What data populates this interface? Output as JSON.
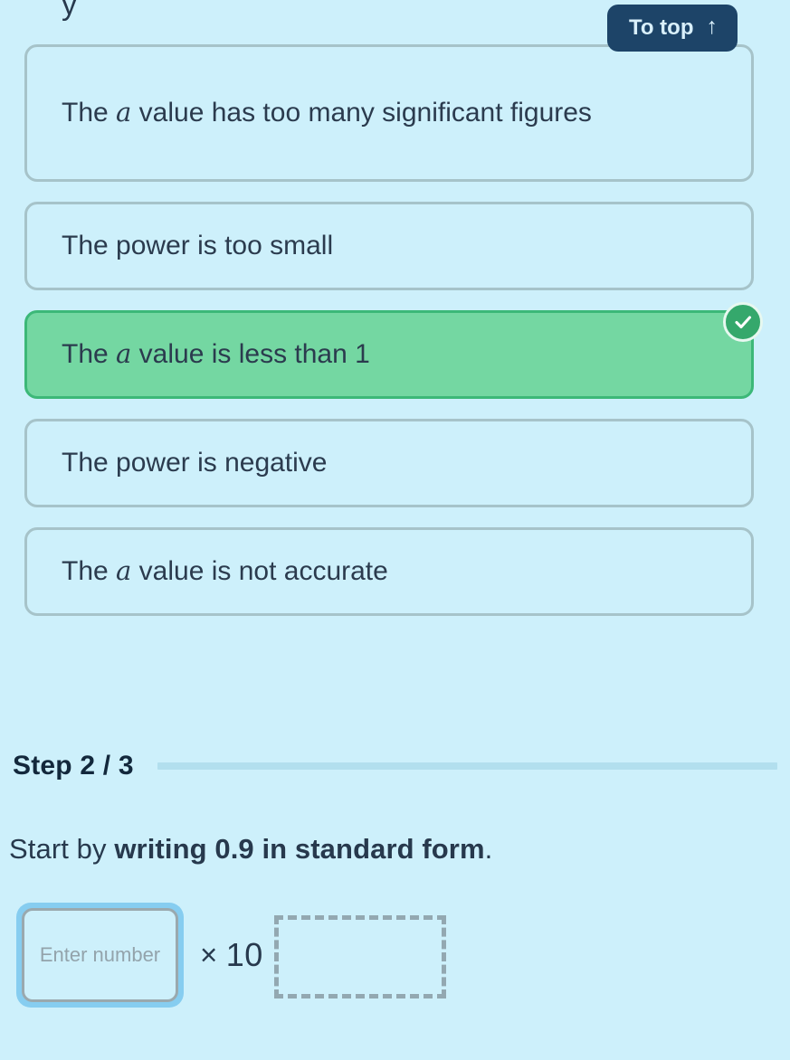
{
  "page": {
    "background_color": "#cdf0fb",
    "text_color": "#27394d",
    "cut_off_descender": "y"
  },
  "to_top": {
    "label": "To top",
    "icon": "arrow-up-icon",
    "arrow_glyph": "↑",
    "background_color": "#1d4468",
    "text_color": "#d9f0fb"
  },
  "options": {
    "selected_index": 2,
    "items": [
      {
        "prefix": "The ",
        "variable": "a",
        "suffix": " value has too many significant figures",
        "full_text": "The a value has too many significant figures",
        "selected": false,
        "lines": 2
      },
      {
        "prefix": "The power is too small",
        "variable": "",
        "suffix": "",
        "full_text": "The power is too small",
        "selected": false,
        "lines": 1
      },
      {
        "prefix": "The ",
        "variable": "a",
        "suffix": " value is less than 1",
        "full_text": "The a value is less than 1",
        "selected": true,
        "lines": 1
      },
      {
        "prefix": "The power is negative",
        "variable": "",
        "suffix": "",
        "full_text": "The power is negative",
        "selected": false,
        "lines": 1
      },
      {
        "prefix": "The ",
        "variable": "a",
        "suffix": " value is not accurate",
        "full_text": "The a value is not accurate",
        "selected": false,
        "lines": 1
      }
    ],
    "colors": {
      "background": "#cdf0fb",
      "border": "#a6c3c9",
      "selected_background": "#74d7a2",
      "selected_border": "#3cb878",
      "check_badge": "#35a86c"
    }
  },
  "check_badge": {
    "icon": "check-circle-icon"
  },
  "step": {
    "label": "Step 2 / 3",
    "current": 2,
    "total": 3,
    "track_color": "#b2dfee"
  },
  "instruction": {
    "lead": "Start by ",
    "bold": "writing 0.9 in standard form",
    "tail": "."
  },
  "answer": {
    "input_value": "",
    "input_placeholder": "Enter number",
    "multiply_symbol": "×",
    "base": "10",
    "exponent_value": "",
    "focus_ring_color": "#86cdf0",
    "input_border_color": "#9aa9ae",
    "exponent_border_color": "#93a8b1"
  }
}
